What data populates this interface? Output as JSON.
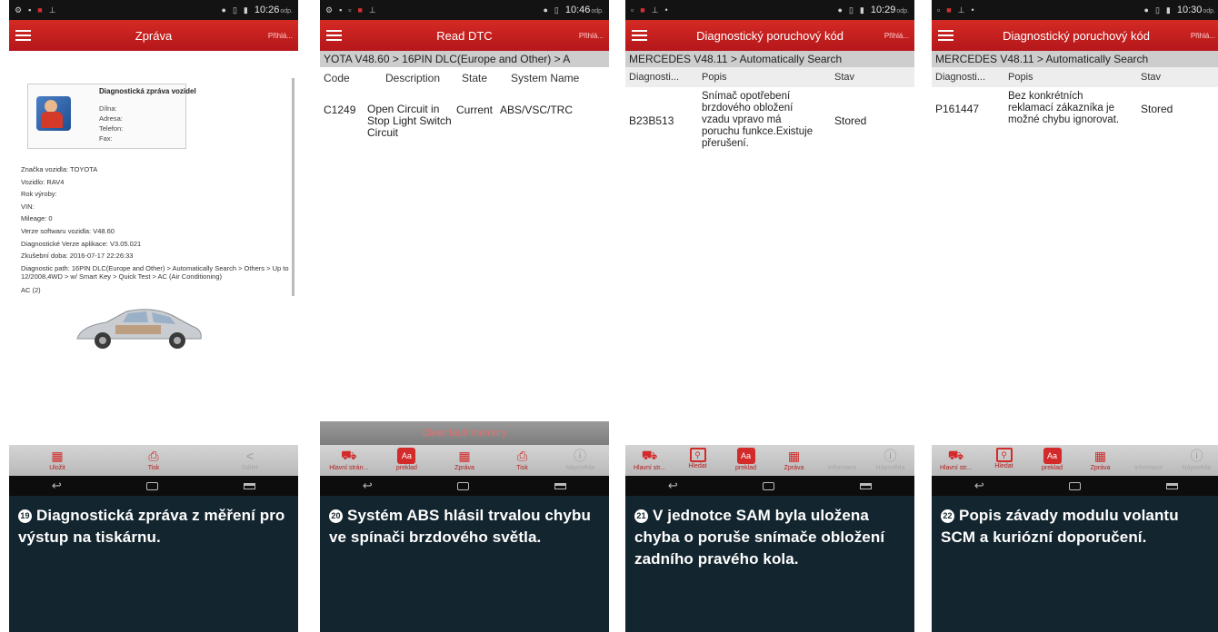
{
  "panels": [
    {
      "status": {
        "time": "10:26",
        "suffix": "odp."
      },
      "title": "Zpráva",
      "report": {
        "heading": "Diagnostická zpráva vozidel",
        "shop_fields": [
          "Dílna:",
          "Adresa:",
          "Telefon:",
          "Fax:"
        ],
        "lines": [
          "Značka vozidla: TOYOTA",
          "Vozidlo: RAV4",
          "Rok výroby:",
          "VIN:",
          "Mileage: 0",
          "Verze softwaru vozidla: V48.60",
          "Diagnostické Verze aplikace: V3.05.021",
          "Zkušební doba: 2016-07-17 22:26:33",
          "Diagnostic path: 16PIN DLC(Europe and Other) > Automatically Search > Others > Up to 12/2008,4WD > w/ Smart Key > Quick Test > AC (Air Conditioning)",
          "AC (2)"
        ]
      },
      "toolbar": [
        "Uložit",
        "Tisk",
        "Sdílet"
      ],
      "caption_num": "19",
      "caption": "Diagnostická zpráva z měření pro výstup na tiskárnu."
    },
    {
      "status": {
        "time": "10:46",
        "suffix": "odp."
      },
      "title": "Read DTC",
      "login": "Přihlá...",
      "breadcrumb": "YOTA V48.60 > 16PIN DLC(Europe and Other) > A",
      "columns": [
        "Code",
        "Description",
        "State",
        "System Name"
      ],
      "rows": [
        {
          "code": "C1249",
          "desc": "Open Circuit in Stop Light Switch Circuit",
          "state": "Current",
          "system": "ABS/VSC/TRC"
        }
      ],
      "clear_label": "Clear fault memory",
      "toolbar": [
        "Hlavní strán...",
        "preklad",
        "Zpráva",
        "Tisk",
        "Nápověda"
      ],
      "caption_num": "20",
      "caption": "Systém ABS hlásil trvalou chybu ve spínači brzdového světla."
    },
    {
      "status": {
        "time": "10:29",
        "suffix": "odp."
      },
      "title": "Diagnostický poruchový kód",
      "login": "Přihlá...",
      "breadcrumb": "MERCEDES V48.11 > Automatically Search",
      "columns": [
        "Diagnosti...",
        "Popis",
        "Stav"
      ],
      "rows": [
        {
          "code": "B23B513",
          "desc": "Snímač opotřebení brzdového obložení vzadu vpravo má poruchu funkce.Existuje přerušení.",
          "state": "Stored"
        }
      ],
      "toolbar": [
        "Hlavní str...",
        "Hledat",
        "preklad",
        "Zpráva",
        "Informace",
        "Nápověda"
      ],
      "caption_num": "21",
      "caption": "V jednotce SAM byla uložena chyba o poruše snímače obložení zadního pravého kola."
    },
    {
      "status": {
        "time": "10:30",
        "suffix": "odp."
      },
      "title": "Diagnostický poruchový kód",
      "login": "Přihlá...",
      "breadcrumb": "MERCEDES V48.11 > Automatically Search",
      "columns": [
        "Diagnosti...",
        "Popis",
        "Stav"
      ],
      "rows": [
        {
          "code": "P161447",
          "desc": "Bez konkrétních reklamací zákazníka je možné chybu ignorovat.",
          "state": "Stored"
        }
      ],
      "toolbar": [
        "Hlavní str...",
        "Hledat",
        "preklad",
        "Zpráva",
        "Informace",
        "Nápověda"
      ],
      "caption_num": "22",
      "caption": "Popis závady modulu volantu SCM a kuriózní doporučení."
    }
  ],
  "icons": [
    "menu-icon",
    "calendar-save-icon",
    "printer-icon",
    "share-icon",
    "car-home-icon",
    "search-icon",
    "translate-icon",
    "report-icon",
    "info-icon",
    "back-icon",
    "home-icon",
    "recents-icon"
  ],
  "colors": {
    "accent": "#c4201f",
    "caption_bg": "#13252f",
    "status_bar": "#131313"
  }
}
